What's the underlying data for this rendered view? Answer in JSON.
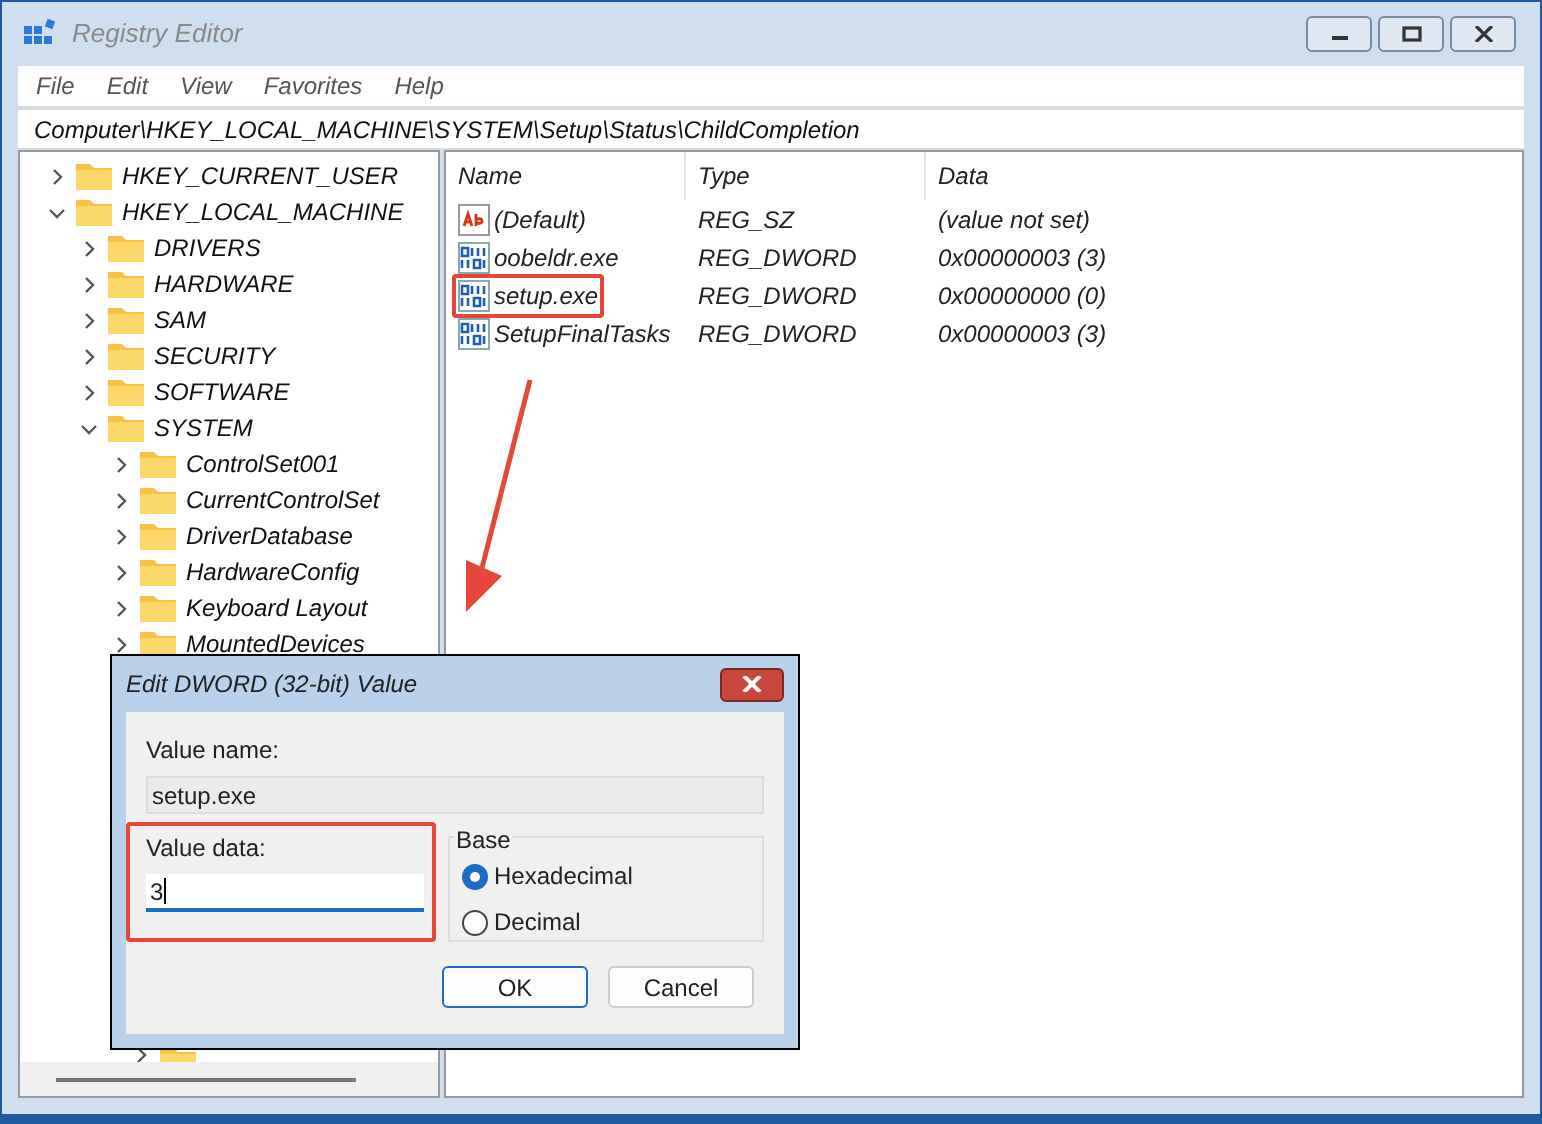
{
  "window": {
    "title": "Registry Editor"
  },
  "menu": [
    "File",
    "Edit",
    "View",
    "Favorites",
    "Help"
  ],
  "address": "Computer\\HKEY_LOCAL_MACHINE\\SYSTEM\\Setup\\Status\\ChildCompletion",
  "tree": [
    {
      "label": "HKEY_CURRENT_USER",
      "expanded": false
    },
    {
      "label": "HKEY_LOCAL_MACHINE",
      "expanded": true,
      "children": [
        {
          "label": "DRIVERS",
          "expanded": false
        },
        {
          "label": "HARDWARE",
          "expanded": false
        },
        {
          "label": "SAM",
          "expanded": false
        },
        {
          "label": "SECURITY",
          "expanded": false
        },
        {
          "label": "SOFTWARE",
          "expanded": false
        },
        {
          "label": "SYSTEM",
          "expanded": true,
          "children": [
            {
              "label": "ControlSet001",
              "expanded": false
            },
            {
              "label": "CurrentControlSet",
              "expanded": false
            },
            {
              "label": "DriverDatabase",
              "expanded": false
            },
            {
              "label": "HardwareConfig",
              "expanded": false
            },
            {
              "label": "Keyboard Layout",
              "expanded": false
            },
            {
              "label": "MountedDevices",
              "expanded": false
            }
          ]
        }
      ]
    }
  ],
  "tree_tail_expanded": false,
  "table": {
    "columns": [
      "Name",
      "Type",
      "Data"
    ],
    "rows": [
      {
        "kind": "string",
        "name": "(Default)",
        "type": "REG_SZ",
        "data": "(value not set)",
        "highlighted": false
      },
      {
        "kind": "binary",
        "name": "oobeldr.exe",
        "type": "REG_DWORD",
        "data": "0x00000003 (3)",
        "highlighted": false
      },
      {
        "kind": "binary",
        "name": "setup.exe",
        "type": "REG_DWORD",
        "data": "0x00000000 (0)",
        "highlighted": true
      },
      {
        "kind": "binary",
        "name": "SetupFinalTasks",
        "type": "REG_DWORD",
        "data": "0x00000003 (3)",
        "highlighted": false
      }
    ]
  },
  "dialog": {
    "title": "Edit DWORD (32-bit) Value",
    "name_label": "Value name:",
    "name_value": "setup.exe",
    "data_label": "Value data:",
    "data_value": "3",
    "data_highlighted": true,
    "base_label": "Base",
    "bases": [
      {
        "label": "Hexadecimal",
        "selected": true
      },
      {
        "label": "Decimal",
        "selected": false
      }
    ],
    "buttons": [
      "OK",
      "Cancel"
    ]
  }
}
